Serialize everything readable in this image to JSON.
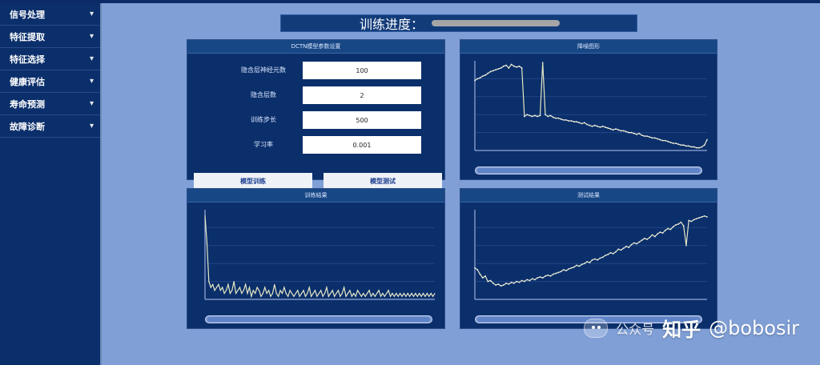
{
  "sidebar": {
    "items": [
      {
        "label": "信号处理"
      },
      {
        "label": "特征提取"
      },
      {
        "label": "特征选择"
      },
      {
        "label": "健康评估"
      },
      {
        "label": "寿命预测"
      },
      {
        "label": "故障诊断"
      }
    ]
  },
  "progress": {
    "label": "训练进度：",
    "value": 1.0
  },
  "param_panel": {
    "title": "DCTN模型参数设置",
    "fields": [
      {
        "label": "隐含层神经元数",
        "value": "100"
      },
      {
        "label": "隐含层数",
        "value": "2"
      },
      {
        "label": "训练步长",
        "value": "500"
      },
      {
        "label": "学习率",
        "value": "0.001"
      }
    ],
    "buttons": {
      "train": "模型训练",
      "test": "模型测试"
    }
  },
  "charts": {
    "top_right": {
      "title": "降噪图形",
      "chart_data": {
        "type": "line",
        "x": [
          1,
          2,
          3,
          4,
          5,
          6,
          7,
          8,
          9,
          10,
          11,
          12,
          13,
          14,
          15,
          16,
          17,
          18,
          19,
          20,
          21,
          22,
          23,
          24,
          25,
          26,
          27,
          28,
          29,
          30,
          31,
          32,
          33,
          34,
          35,
          36,
          37,
          38,
          39,
          40,
          41,
          42,
          43,
          44,
          45,
          46,
          47,
          48,
          49,
          50,
          51,
          52,
          53,
          54,
          55,
          56,
          57,
          58,
          59,
          60,
          61,
          62,
          63,
          64,
          65,
          66,
          67,
          68,
          69,
          70,
          71,
          72,
          73,
          74,
          75,
          76,
          77,
          78,
          79,
          80,
          81,
          82,
          83,
          84,
          85,
          86,
          87,
          88,
          89,
          90
        ],
        "y": [
          0.78,
          0.8,
          0.81,
          0.83,
          0.84,
          0.86,
          0.88,
          0.89,
          0.9,
          0.91,
          0.92,
          0.94,
          0.95,
          0.92,
          0.96,
          0.94,
          0.93,
          0.94,
          0.92,
          0.38,
          0.4,
          0.39,
          0.38,
          0.39,
          0.38,
          0.39,
          0.98,
          0.4,
          0.38,
          0.39,
          0.37,
          0.36,
          0.36,
          0.35,
          0.34,
          0.34,
          0.33,
          0.33,
          0.32,
          0.32,
          0.31,
          0.3,
          0.31,
          0.29,
          0.28,
          0.27,
          0.28,
          0.27,
          0.26,
          0.27,
          0.26,
          0.25,
          0.24,
          0.23,
          0.24,
          0.23,
          0.22,
          0.22,
          0.21,
          0.2,
          0.2,
          0.19,
          0.18,
          0.19,
          0.17,
          0.16,
          0.16,
          0.15,
          0.14,
          0.14,
          0.13,
          0.12,
          0.11,
          0.11,
          0.1,
          0.09,
          0.08,
          0.08,
          0.07,
          0.06,
          0.06,
          0.05,
          0.05,
          0.04,
          0.04,
          0.03,
          0.03,
          0.04,
          0.06,
          0.12
        ],
        "ylim": [
          0,
          1
        ]
      }
    },
    "bottom_left": {
      "title": "训练结果",
      "chart_data": {
        "type": "line",
        "x": [
          1,
          2,
          3,
          4,
          5,
          6,
          7,
          8,
          9,
          10,
          11,
          12,
          13,
          14,
          15,
          16,
          17,
          18,
          19,
          20,
          21,
          22,
          23,
          24,
          25,
          26,
          27,
          28,
          29,
          30,
          31,
          32,
          33,
          34,
          35,
          36,
          37,
          38,
          39,
          40,
          41,
          42,
          43,
          44,
          45,
          46,
          47,
          48,
          49,
          50,
          51,
          52,
          53,
          54,
          55,
          56,
          57,
          58,
          59,
          60,
          61,
          62,
          63,
          64,
          65,
          66,
          67,
          68,
          69,
          70,
          71,
          72,
          73,
          74,
          75,
          76,
          77,
          78,
          79,
          80,
          81,
          82,
          83,
          84,
          85,
          86,
          87,
          88,
          89,
          90,
          91,
          92,
          93,
          94,
          95,
          96,
          97,
          98,
          99,
          100,
          101,
          102,
          103,
          104,
          105,
          106,
          107,
          108,
          109,
          110,
          111,
          112,
          113,
          114,
          115,
          116,
          117,
          118,
          119,
          120
        ],
        "y": [
          0.28,
          0.19,
          0.06,
          0.04,
          0.05,
          0.03,
          0.04,
          0.05,
          0.03,
          0.04,
          0.02,
          0.03,
          0.05,
          0.02,
          0.03,
          0.06,
          0.02,
          0.03,
          0.04,
          0.02,
          0.03,
          0.05,
          0.02,
          0.04,
          0.01,
          0.03,
          0.02,
          0.04,
          0.03,
          0.01,
          0.02,
          0.04,
          0.02,
          0.03,
          0.01,
          0.02,
          0.05,
          0.02,
          0.01,
          0.03,
          0.02,
          0.04,
          0.02,
          0.01,
          0.03,
          0.02,
          0.01,
          0.02,
          0.03,
          0.01,
          0.02,
          0.03,
          0.01,
          0.02,
          0.04,
          0.01,
          0.02,
          0.03,
          0.01,
          0.02,
          0.03,
          0.01,
          0.02,
          0.04,
          0.01,
          0.02,
          0.03,
          0.01,
          0.02,
          0.03,
          0.01,
          0.02,
          0.04,
          0.01,
          0.02,
          0.03,
          0.01,
          0.02,
          0.01,
          0.03,
          0.02,
          0.01,
          0.02,
          0.01,
          0.02,
          0.03,
          0.01,
          0.02,
          0.01,
          0.02,
          0.03,
          0.01,
          0.02,
          0.01,
          0.02,
          0.03,
          0.01,
          0.02,
          0.01,
          0.02,
          0.01,
          0.02,
          0.01,
          0.02,
          0.01,
          0.02,
          0.01,
          0.02,
          0.01,
          0.02,
          0.01,
          0.02,
          0.01,
          0.02,
          0.01,
          0.02,
          0.01,
          0.02,
          0.01,
          0.02
        ],
        "ylim": [
          0,
          0.3
        ]
      }
    },
    "bottom_right": {
      "title": "测试结果",
      "chart_data": {
        "type": "line",
        "x": [
          1,
          2,
          3,
          4,
          5,
          6,
          7,
          8,
          9,
          10,
          11,
          12,
          13,
          14,
          15,
          16,
          17,
          18,
          19,
          20,
          21,
          22,
          23,
          24,
          25,
          26,
          27,
          28,
          29,
          30,
          31,
          32,
          33,
          34,
          35,
          36,
          37,
          38,
          39,
          40,
          41,
          42,
          43,
          44,
          45,
          46,
          47,
          48,
          49,
          50,
          51,
          52,
          53,
          54,
          55,
          56,
          57,
          58,
          59,
          60,
          61,
          62,
          63,
          64,
          65,
          66,
          67,
          68,
          69,
          70,
          71,
          72,
          73,
          74,
          75,
          76,
          77,
          78,
          79,
          80,
          81,
          82,
          83,
          84,
          85,
          86,
          87,
          88,
          89,
          90
        ],
        "y": [
          0.35,
          0.33,
          0.28,
          0.24,
          0.26,
          0.2,
          0.21,
          0.18,
          0.16,
          0.17,
          0.15,
          0.16,
          0.18,
          0.17,
          0.19,
          0.18,
          0.2,
          0.19,
          0.21,
          0.2,
          0.22,
          0.21,
          0.23,
          0.22,
          0.24,
          0.25,
          0.24,
          0.26,
          0.27,
          0.26,
          0.28,
          0.29,
          0.3,
          0.31,
          0.33,
          0.32,
          0.34,
          0.35,
          0.36,
          0.38,
          0.37,
          0.39,
          0.4,
          0.42,
          0.41,
          0.44,
          0.45,
          0.44,
          0.46,
          0.47,
          0.49,
          0.5,
          0.52,
          0.51,
          0.53,
          0.56,
          0.55,
          0.57,
          0.59,
          0.58,
          0.61,
          0.63,
          0.62,
          0.64,
          0.66,
          0.68,
          0.67,
          0.69,
          0.72,
          0.7,
          0.73,
          0.75,
          0.74,
          0.77,
          0.79,
          0.78,
          0.81,
          0.83,
          0.84,
          0.86,
          0.82,
          0.6,
          0.88,
          0.87,
          0.89,
          0.9,
          0.91,
          0.92,
          0.93,
          0.92
        ],
        "ylim": [
          0,
          1
        ]
      }
    }
  },
  "watermark": {
    "left": "公众号",
    "middle": "知乎",
    "handle": "@bobosir"
  }
}
